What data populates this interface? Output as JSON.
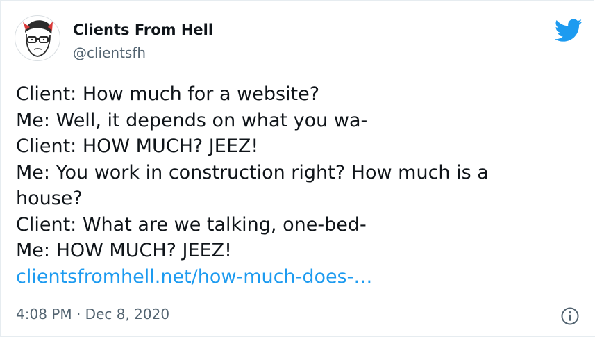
{
  "author": {
    "name": "Clients From Hell",
    "handle": "@clientsfh",
    "avatar_icon": "cartoon-face-avatar-icon"
  },
  "brand": {
    "logo_icon": "twitter-bird-icon",
    "accent_color": "#1d9bf0"
  },
  "tweet": {
    "lines": [
      "Client: How much for a website?",
      "Me: Well, it depends on what you wa-",
      "Client: HOW MUCH? JEEZ!",
      "Me: You work in construction right? How much is a",
      "house?",
      "Client: What are we talking, one-bed-",
      "Me: HOW MUCH? JEEZ!"
    ],
    "link_text": "clientsfromhell.net/how-much-does-…"
  },
  "meta": {
    "time": "4:08 PM",
    "separator": "·",
    "date": "Dec 8, 2020",
    "info_icon": "info-icon"
  }
}
